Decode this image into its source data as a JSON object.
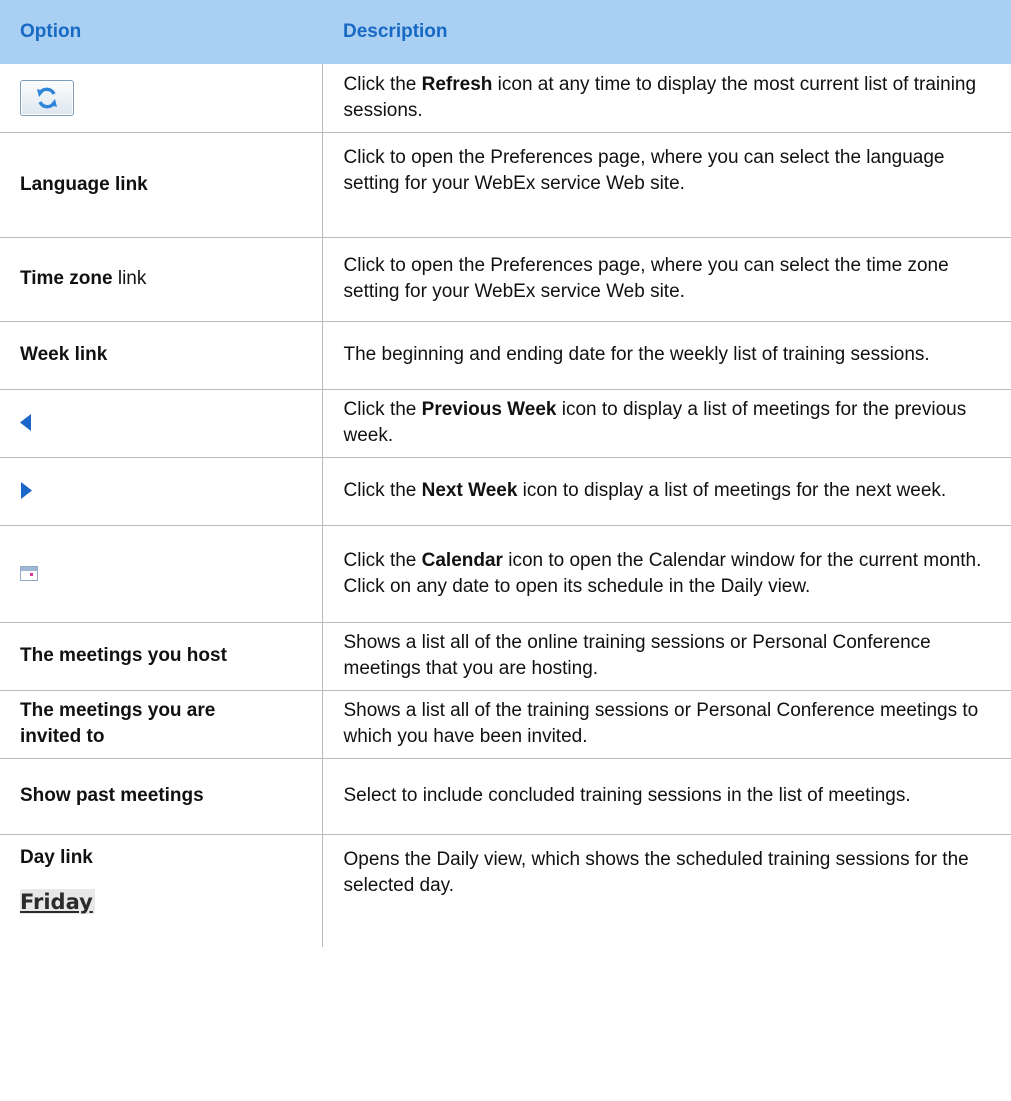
{
  "header": {
    "option": "Option",
    "description": "Description"
  },
  "rows": [
    {
      "option_icon": "refresh-icon",
      "desc_pre": "Click the ",
      "desc_bold": "Refresh",
      "desc_post": " icon at any time to display the most current list of training sessions."
    },
    {
      "option_bold": "Language link",
      "desc": "Click to open the Preferences page, where you can select the language setting for your WebEx service Web site."
    },
    {
      "option_bold": "Time zone",
      "option_plain": " link",
      "desc": "Click to open the Preferences page, where you can select the time zone setting for your WebEx service Web site."
    },
    {
      "option_bold": "Week link",
      "desc": "The beginning and ending date for the weekly list of training sessions."
    },
    {
      "option_icon": "previous-week-icon",
      "desc_pre": "Click the ",
      "desc_bold": "Previous Week",
      "desc_post": " icon to display a list of meetings for the previous week."
    },
    {
      "option_icon": "next-week-icon",
      "desc_pre": "Click the ",
      "desc_bold": "Next Week",
      "desc_post": " icon to display a list of meetings for the next week."
    },
    {
      "option_icon": "calendar-icon",
      "desc_pre": "Click the ",
      "desc_bold": "Calendar",
      "desc_post": " icon to open the Calendar window for the current month. Click on any date to open its schedule in the Daily view."
    },
    {
      "option_bold": "The meetings you host",
      "desc": "Shows a list all of the online training sessions or Personal Conference meetings that you are hosting."
    },
    {
      "option_bold": "The meetings you are invited to",
      "desc": "Shows a list all of the training sessions or Personal Conference meetings to which you have been invited."
    },
    {
      "option_bold": "Show past meetings",
      "desc": "Select to include concluded training sessions in the list of meetings."
    },
    {
      "option_bold": "Day link",
      "option_sample": "Friday",
      "desc": "Opens the Daily view, which shows the scheduled training sessions for the selected day."
    }
  ],
  "colors": {
    "header_bg": "#a9d0f3",
    "header_text": "#1769c4",
    "grid_line": "#b9b9b9",
    "arrow_blue": "#1b66c9"
  }
}
